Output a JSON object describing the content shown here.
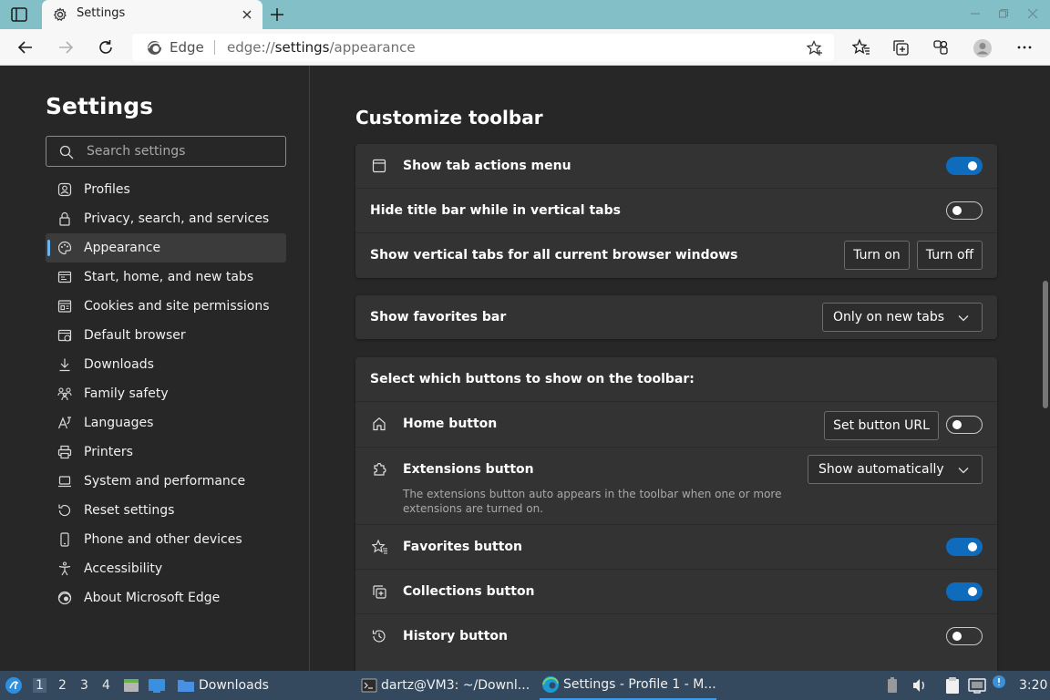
{
  "window": {
    "tab_title": "Settings",
    "address_prefix": "Edge",
    "url_scheme": "edge://",
    "url_host": "settings",
    "url_path": "/appearance"
  },
  "sidebar": {
    "title": "Settings",
    "search_placeholder": "Search settings",
    "items": [
      {
        "label": "Profiles",
        "icon": "profile-icon"
      },
      {
        "label": "Privacy, search, and services",
        "icon": "lock-icon"
      },
      {
        "label": "Appearance",
        "icon": "palette-icon",
        "active": true
      },
      {
        "label": "Start, home, and new tabs",
        "icon": "window-icon"
      },
      {
        "label": "Cookies and site permissions",
        "icon": "cookies-icon"
      },
      {
        "label": "Default browser",
        "icon": "default-browser-icon"
      },
      {
        "label": "Downloads",
        "icon": "download-icon"
      },
      {
        "label": "Family safety",
        "icon": "family-icon"
      },
      {
        "label": "Languages",
        "icon": "languages-icon"
      },
      {
        "label": "Printers",
        "icon": "printer-icon"
      },
      {
        "label": "System and performance",
        "icon": "laptop-icon"
      },
      {
        "label": "Reset settings",
        "icon": "reset-icon"
      },
      {
        "label": "Phone and other devices",
        "icon": "phone-icon"
      },
      {
        "label": "Accessibility",
        "icon": "accessibility-icon"
      },
      {
        "label": "About Microsoft Edge",
        "icon": "edge-icon"
      }
    ]
  },
  "main": {
    "section_title": "Customize toolbar",
    "card1": {
      "show_tab_actions": {
        "label": "Show tab actions menu",
        "on": true
      },
      "hide_title_bar": {
        "label": "Hide title bar while in vertical tabs",
        "on": false
      },
      "vertical_tabs": {
        "label": "Show vertical tabs for all current browser windows",
        "turn_on": "Turn on",
        "turn_off": "Turn off"
      }
    },
    "favorites_bar": {
      "label": "Show favorites bar",
      "value": "Only on new tabs"
    },
    "buttons_section": {
      "heading": "Select which buttons to show on the toolbar:",
      "home": {
        "label": "Home button",
        "set_url": "Set button URL",
        "on": false
      },
      "extensions": {
        "label": "Extensions button",
        "value": "Show automatically",
        "description": "The extensions button auto appears in the toolbar when one or more extensions are turned on."
      },
      "favorites": {
        "label": "Favorites button",
        "on": true
      },
      "collections": {
        "label": "Collections button",
        "on": true
      },
      "history": {
        "label": "History button",
        "on": false
      }
    }
  },
  "taskbar": {
    "workspaces": [
      "1",
      "2",
      "3",
      "4"
    ],
    "downloads_label": "Downloads",
    "terminal_task": "dartz@VM3: ~/Downl...",
    "edge_task": "Settings - Profile 1 - M...",
    "clock": "3:20"
  },
  "colors": {
    "accent": "#0f6cbd",
    "titlebar": "#83bfc7",
    "taskbar": "#34495e",
    "background": "#272727",
    "card": "#333333"
  }
}
